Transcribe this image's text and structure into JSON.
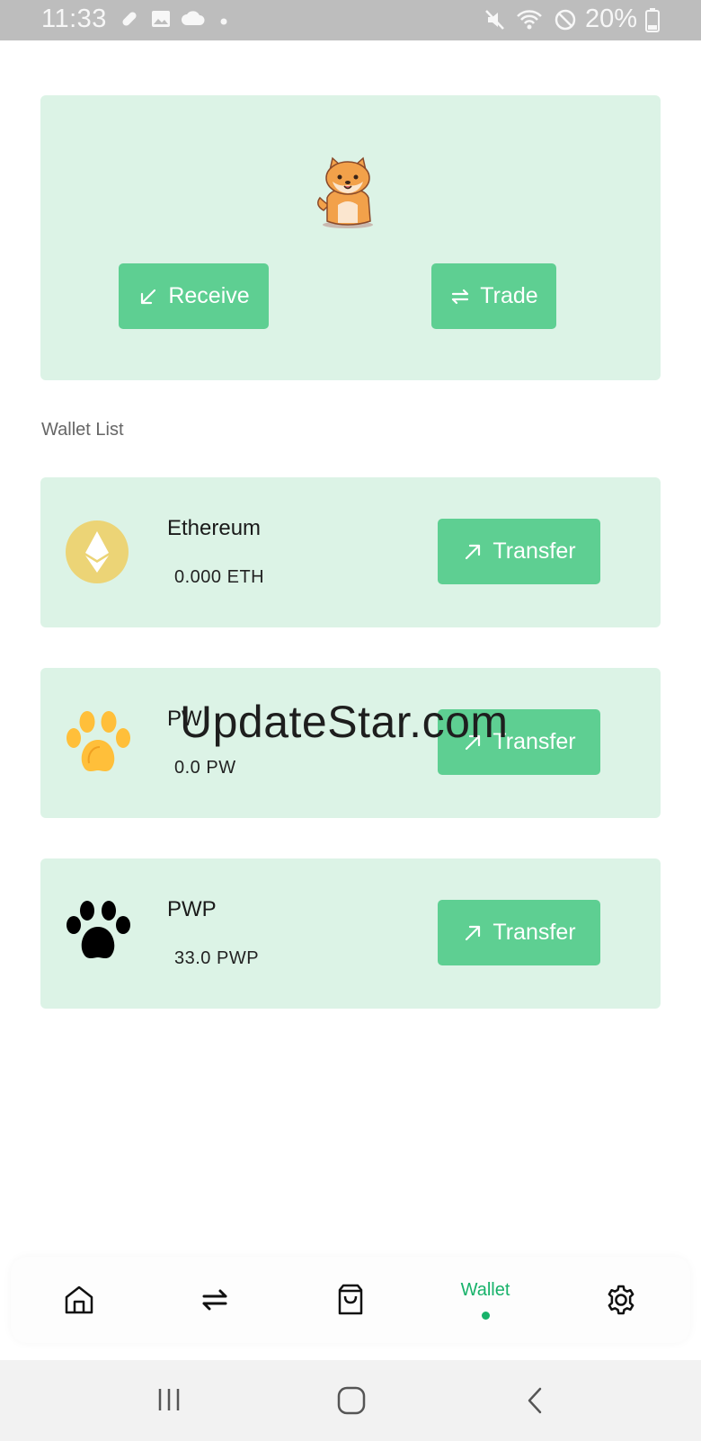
{
  "status_bar": {
    "time": "11:33",
    "battery": "20%",
    "icons": [
      "pill-icon",
      "image-icon",
      "cloud-icon",
      "dot-icon",
      "mute-icon",
      "wifi-icon",
      "do-not-disturb-icon",
      "battery-icon"
    ]
  },
  "hero": {
    "mascot_icon": "shiba-dog-icon",
    "receive_label": "Receive",
    "trade_label": "Trade"
  },
  "wallet_list": {
    "title": "Wallet List",
    "wallets": [
      {
        "name": "Ethereum",
        "balance": "0.000 ETH",
        "icon": "ethereum-icon",
        "transfer_label": "Transfer"
      },
      {
        "name": "PW",
        "balance": "0.0 PW",
        "icon": "orange-paw-icon",
        "transfer_label": "Transfer"
      },
      {
        "name": "PWP",
        "balance": "33.0 PWP",
        "icon": "black-paw-icon",
        "transfer_label": "Transfer"
      }
    ]
  },
  "watermark": "UpdateStar.com",
  "bottom_nav": {
    "items": [
      "home-icon",
      "swap-icon",
      "shopping-bag-icon",
      "Wallet",
      "settings-icon"
    ],
    "active": "Wallet"
  },
  "system_nav": [
    "recents-icon",
    "home-icon",
    "back-icon"
  ],
  "colors": {
    "accent": "#5ecf92",
    "card_bg": "#dcf3e6",
    "active_tab": "#17b26a"
  }
}
